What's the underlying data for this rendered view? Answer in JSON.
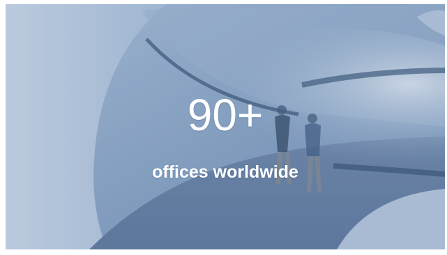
{
  "stat": {
    "number": "90+",
    "caption": "offices worldwide"
  },
  "colors": {
    "overlay": "#5c7eaa",
    "text": "#ffffff"
  },
  "image": {
    "icon": "corridor-photo"
  }
}
